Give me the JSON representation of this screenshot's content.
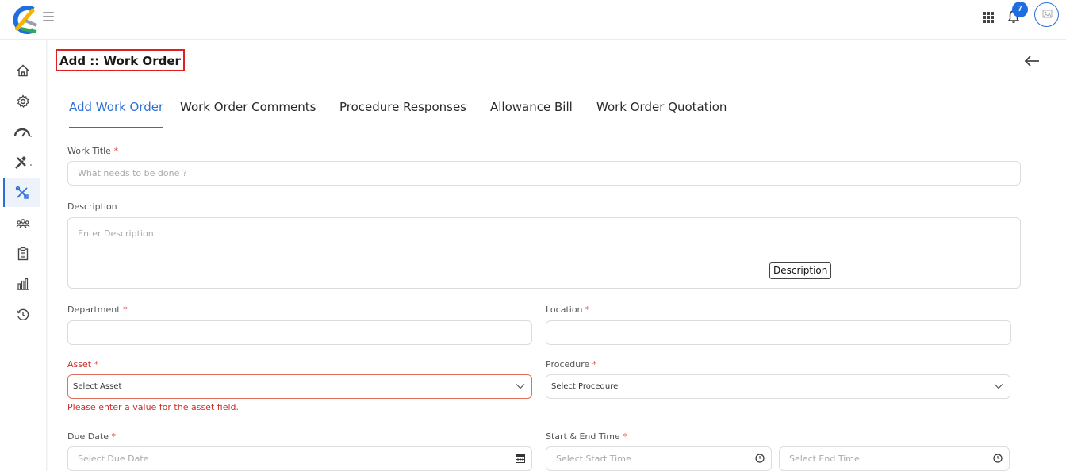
{
  "header": {
    "notification_count": "7",
    "brand_colors": [
      "#1e6ee0",
      "#f4b400",
      "#34a853",
      "#ea4335"
    ]
  },
  "sidebar": {
    "items": [
      {
        "icon": "home-icon"
      },
      {
        "icon": "gear-icon"
      },
      {
        "icon": "gauge-icon"
      },
      {
        "icon": "tools-icon"
      },
      {
        "icon": "wrench-screwdriver-icon",
        "active": true
      },
      {
        "icon": "team-icon"
      },
      {
        "icon": "clipboard-icon"
      },
      {
        "icon": "bar-chart-icon"
      },
      {
        "icon": "history-icon"
      }
    ]
  },
  "page": {
    "title": "Add :: Work Order"
  },
  "tabs": [
    {
      "label": "Add Work Order",
      "active": true
    },
    {
      "label": "Work Order Comments"
    },
    {
      "label": "Procedure Responses"
    },
    {
      "label": "Allowance Bill"
    },
    {
      "label": "Work Order Quotation"
    }
  ],
  "form": {
    "work_title": {
      "label": "Work Title",
      "required": "*",
      "placeholder": "What needs to be done ?"
    },
    "description": {
      "label": "Description",
      "placeholder": "Enter Description",
      "tooltip": "Description"
    },
    "department": {
      "label": "Department",
      "required": "*",
      "value": ""
    },
    "location": {
      "label": "Location",
      "required": "*",
      "value": ""
    },
    "asset": {
      "label": "Asset",
      "required": "*",
      "value": "Select Asset",
      "error": "Please enter a value for the asset field."
    },
    "procedure": {
      "label": "Procedure",
      "required": "*",
      "value": "Select Procedure"
    },
    "due_date": {
      "label": "Due Date",
      "required": "*",
      "placeholder": "Select Due Date"
    },
    "start_end": {
      "label": "Start & End Time",
      "required": "*",
      "start_placeholder": "Select Start Time",
      "end_placeholder": "Select End Time"
    }
  },
  "colors": {
    "accent": "#2b6fd6",
    "error": "#c9302c",
    "highlight_box": "#e01f1f"
  }
}
